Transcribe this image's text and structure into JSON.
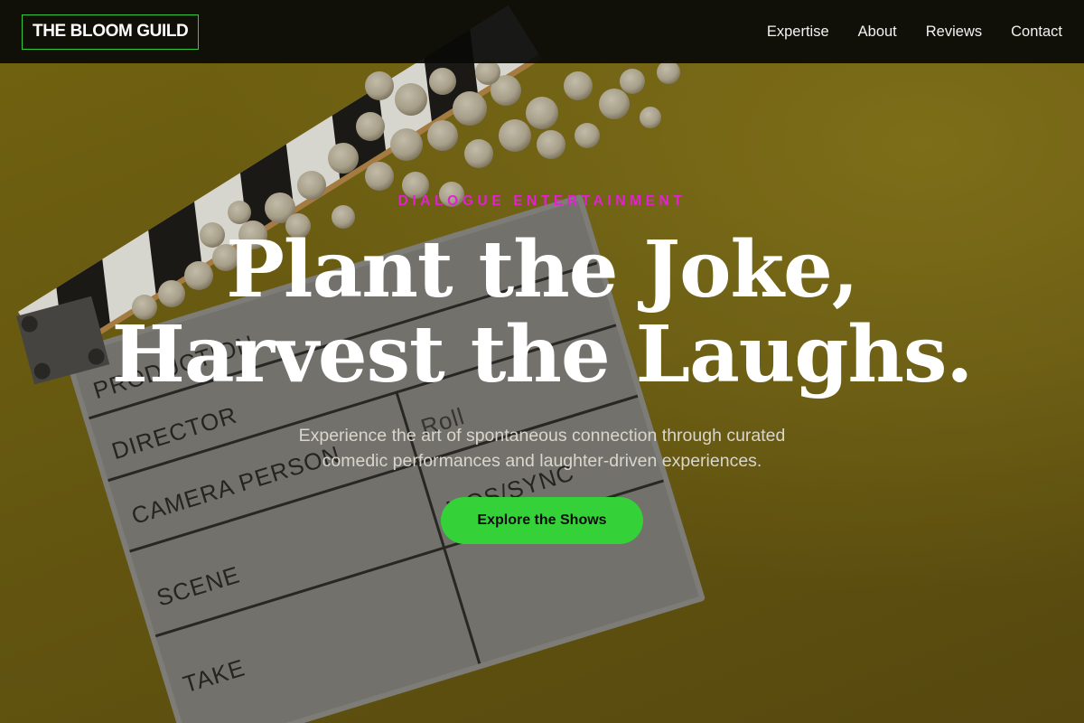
{
  "nav": {
    "logo": "THE BLOOM GUILD",
    "links": [
      {
        "label": "Expertise"
      },
      {
        "label": "About"
      },
      {
        "label": "Reviews"
      },
      {
        "label": "Contact"
      }
    ]
  },
  "hero": {
    "eyebrow": "DIALOGUE ENTERTAINMENT",
    "headline_line1": "Plant the Joke,",
    "headline_line2": "Harvest the Laughs.",
    "subtitle_line1": "Experience the art of spontaneous connection through curated",
    "subtitle_line2": "comedic performances and laughter-driven experiences.",
    "cta_label": "Explore the Shows"
  },
  "background_image": {
    "clapperboard_fields": [
      "PRODUCTION",
      "DIRECTOR",
      "CAMERA PERSON",
      "Roll",
      "SCENE",
      "MOS/SYNC",
      "TAKE"
    ]
  },
  "colors": {
    "accent_green": "#34d139",
    "logo_border": "#36c93b",
    "eyebrow_magenta": "#e51fd3",
    "nav_bg": "#0a0a08",
    "hero_yellow": "#7a6a12"
  }
}
